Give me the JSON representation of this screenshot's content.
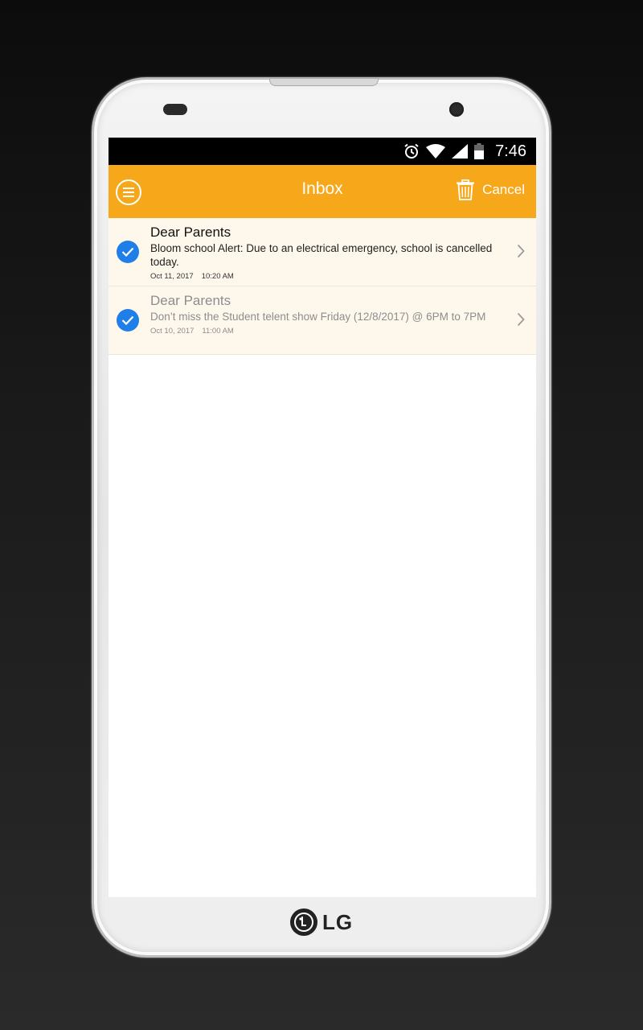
{
  "statusbar": {
    "time": "7:46",
    "icons": [
      "alarm-icon",
      "wifi-icon",
      "signal-icon",
      "battery-icon"
    ]
  },
  "appbar": {
    "title": "Inbox",
    "cancel_label": "Cancel",
    "menu_icon": "menu-icon",
    "delete_icon": "trash-icon"
  },
  "messages": [
    {
      "title": "Dear Parents",
      "text": "Bloom school Alert: Due to an electrical emergency, school is cancelled today.",
      "date": "Oct 11, 2017",
      "time": "10:20 AM",
      "selected": true,
      "read": false
    },
    {
      "title": "Dear Parents",
      "text": "Don’t miss the Student telent show Friday (12/8/2017) @ 6PM to 7PM",
      "date": "Oct 10, 2017",
      "time": "11:00 AM",
      "selected": true,
      "read": true
    }
  ],
  "device": {
    "brand": "LG"
  },
  "colors": {
    "accent": "#f6a71a",
    "check": "#1f7ee8",
    "row_bg": "#fef8ec"
  }
}
